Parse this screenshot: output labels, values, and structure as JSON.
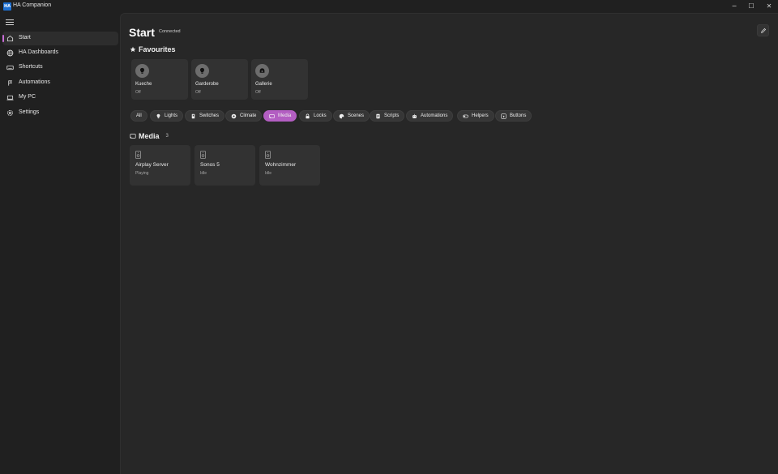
{
  "window": {
    "app_icon_text": "HA",
    "title": "HA Companion",
    "minimize": "─",
    "maximize": "☐",
    "close": "✕"
  },
  "sidebar": {
    "items": [
      {
        "label": "Start",
        "icon": "home-icon",
        "active": true
      },
      {
        "label": "HA Dashboards",
        "icon": "globe-icon"
      },
      {
        "label": "Shortcuts",
        "icon": "keyboard-icon"
      },
      {
        "label": "Automations",
        "icon": "automation-icon"
      },
      {
        "label": "My PC",
        "icon": "laptop-icon"
      },
      {
        "label": "Settings",
        "icon": "gear-icon"
      }
    ]
  },
  "header": {
    "title": "Start",
    "status": "Connected"
  },
  "favourites": {
    "title": "Favourites",
    "items": [
      {
        "name": "Kueche",
        "state": "Off",
        "icon": "bulb-icon"
      },
      {
        "name": "Garderobe",
        "state": "Off",
        "icon": "bulb-icon"
      },
      {
        "name": "Gallerie",
        "state": "Off",
        "icon": "lamp-icon"
      }
    ]
  },
  "filters": [
    {
      "label": "All"
    },
    {
      "label": "Lights",
      "icon": "bulb-icon"
    },
    {
      "label": "Switches",
      "icon": "switch-icon"
    },
    {
      "label": "Climate",
      "icon": "climate-icon"
    },
    {
      "label": "Media",
      "icon": "cast-icon",
      "selected": true
    },
    {
      "label": "Locks",
      "icon": "lock-icon"
    },
    {
      "label": "Scenes",
      "icon": "palette-icon"
    },
    {
      "label": "Scripts",
      "icon": "script-icon"
    },
    {
      "label": "Automations",
      "icon": "robot-icon"
    },
    {
      "label": "Helpers",
      "icon": "toggle-icon"
    },
    {
      "label": "Buttons",
      "icon": "button-icon"
    }
  ],
  "media": {
    "title": "Media",
    "count": "3",
    "items": [
      {
        "name": "Airplay Server",
        "state": "Playing",
        "icon": "speaker-icon"
      },
      {
        "name": "Sonos 5",
        "state": "Idle",
        "icon": "speaker-icon"
      },
      {
        "name": "Wohnzimmer",
        "state": "Idle",
        "icon": "speaker-icon"
      }
    ]
  },
  "colors": {
    "accent": "#c86dd7",
    "chip_selected": "#b35ec2",
    "background": "#202020",
    "content": "#272727",
    "card": "#323232"
  }
}
